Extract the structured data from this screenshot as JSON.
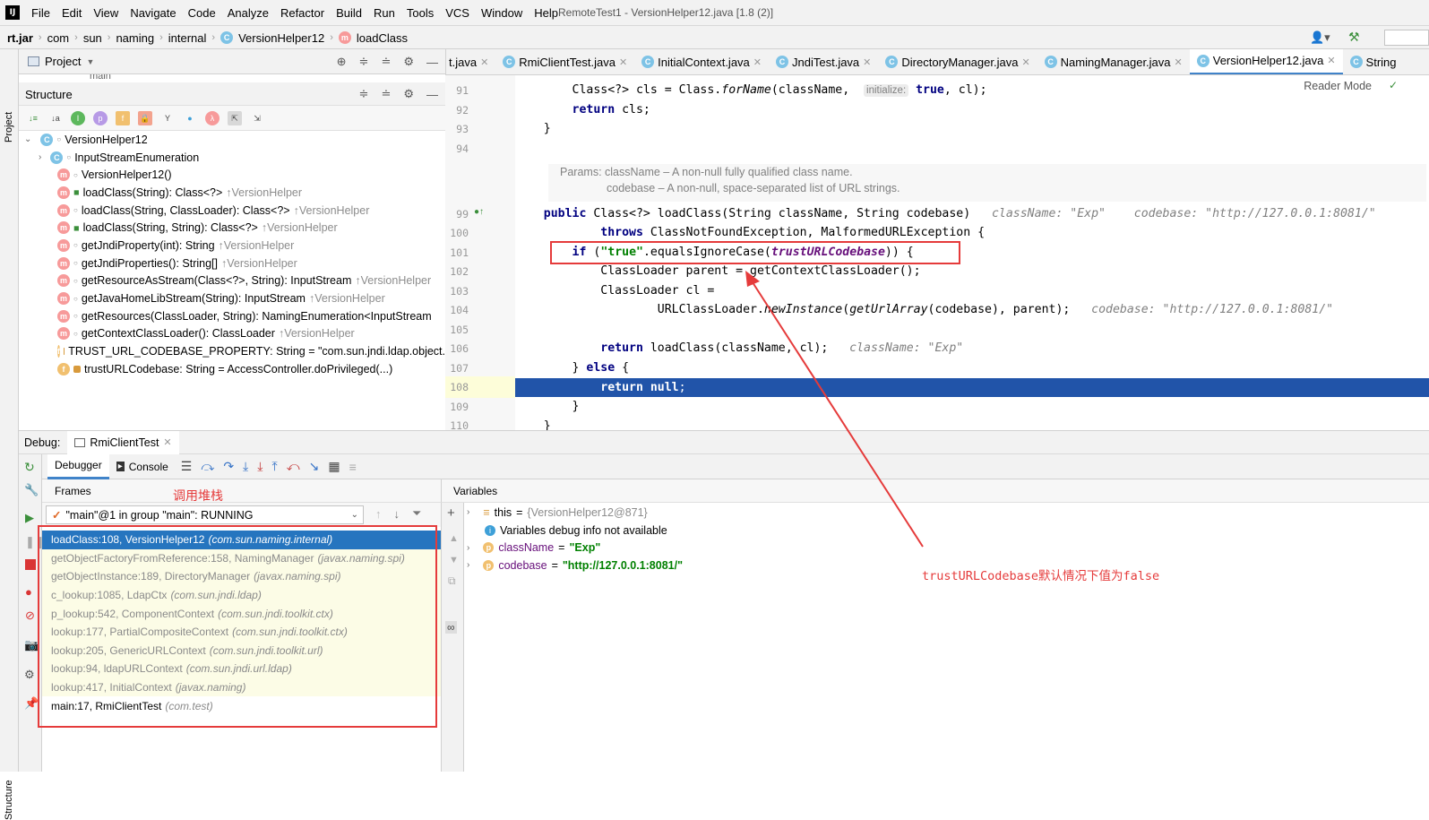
{
  "menubar": {
    "logo": "IJ",
    "items": [
      "File",
      "Edit",
      "View",
      "Navigate",
      "Code",
      "Analyze",
      "Refactor",
      "Build",
      "Run",
      "Tools",
      "VCS",
      "Window",
      "Help"
    ],
    "window_title": "RemoteTest1 - VersionHelper12.java [1.8 (2)]"
  },
  "breadcrumb": {
    "items": [
      "rt.jar",
      "com",
      "sun",
      "naming",
      "internal",
      "VersionHelper12",
      "loadClass"
    ]
  },
  "project_panel": {
    "title": "Project",
    "hidden_row": "main"
  },
  "left_strip": {
    "project": "Project",
    "structure": "Structure"
  },
  "structure": {
    "title": "Structure",
    "root": "VersionHelper12",
    "items": [
      {
        "icon": "c",
        "name": "InputStreamEnumeration",
        "type": "",
        "inherit": "",
        "expand": true
      },
      {
        "icon": "m",
        "name": "VersionHelper12()",
        "type": "",
        "inherit": ""
      },
      {
        "icon": "m",
        "name": "loadClass(String): Class<?>",
        "type": "",
        "inherit": "↑VersionHelper"
      },
      {
        "icon": "m",
        "name": "loadClass(String, ClassLoader): Class<?>",
        "type": "",
        "inherit": "↑VersionHelper"
      },
      {
        "icon": "m",
        "name": "loadClass(String, String): Class<?>",
        "type": "",
        "inherit": "↑VersionHelper"
      },
      {
        "icon": "m",
        "name": "getJndiProperty(int): String",
        "type": "",
        "inherit": "↑VersionHelper"
      },
      {
        "icon": "m",
        "name": "getJndiProperties(): String[]",
        "type": "",
        "inherit": "↑VersionHelper"
      },
      {
        "icon": "m",
        "name": "getResourceAsStream(Class<?>, String): InputStream",
        "type": "",
        "inherit": "↑VersionHelper"
      },
      {
        "icon": "m",
        "name": "getJavaHomeLibStream(String): InputStream",
        "type": "",
        "inherit": "↑VersionHelper"
      },
      {
        "icon": "m",
        "name": "getResources(ClassLoader, String): NamingEnumeration<InputStream",
        "type": "",
        "inherit": ""
      },
      {
        "icon": "m",
        "name": "getContextClassLoader(): ClassLoader",
        "type": "",
        "inherit": "↑VersionHelper"
      },
      {
        "icon": "f",
        "name": "TRUST_URL_CODEBASE_PROPERTY: String = \"com.sun.jndi.ldap.object.",
        "type": "",
        "inherit": ""
      },
      {
        "icon": "f",
        "name": "trustURLCodebase: String = AccessController.doPrivileged(...)",
        "type": "",
        "inherit": ""
      }
    ]
  },
  "editor_tabs": [
    {
      "label": "t.java",
      "active": false
    },
    {
      "label": "RmiClientTest.java",
      "active": false
    },
    {
      "label": "InitialContext.java",
      "active": false
    },
    {
      "label": "JndiTest.java",
      "active": false
    },
    {
      "label": "DirectoryManager.java",
      "active": false
    },
    {
      "label": "NamingManager.java",
      "active": false
    },
    {
      "label": "VersionHelper12.java",
      "active": true
    },
    {
      "label": "String",
      "active": false
    }
  ],
  "editor": {
    "reader_mode": "Reader Mode",
    "line_numbers": [
      "91",
      "92",
      "93",
      "94",
      "99",
      "100",
      "101",
      "102",
      "103",
      "104",
      "105",
      "106",
      "107",
      "108",
      "109",
      "110"
    ],
    "doc_line1": "Params: className – A non-null fully qualified class name.",
    "doc_line2": "codebase – A non-null, space-separated list of URL strings."
  },
  "debug": {
    "label": "Debug:",
    "session": "RmiClientTest",
    "tabs": [
      "Debugger",
      "Console"
    ],
    "frames_title": "Frames",
    "variables_title": "Variables",
    "thread": "\"main\"@1 in group \"main\": RUNNING",
    "frames": [
      {
        "method": "loadClass:108, VersionHelper12",
        "pkg": "(com.sun.naming.internal)"
      },
      {
        "method": "getObjectFactoryFromReference:158, NamingManager",
        "pkg": "(javax.naming.spi)"
      },
      {
        "method": "getObjectInstance:189, DirectoryManager",
        "pkg": "(javax.naming.spi)"
      },
      {
        "method": "c_lookup:1085, LdapCtx",
        "pkg": "(com.sun.jndi.ldap)"
      },
      {
        "method": "p_lookup:542, ComponentContext",
        "pkg": "(com.sun.jndi.toolkit.ctx)"
      },
      {
        "method": "lookup:177, PartialCompositeContext",
        "pkg": "(com.sun.jndi.toolkit.ctx)"
      },
      {
        "method": "lookup:205, GenericURLContext",
        "pkg": "(com.sun.jndi.toolkit.url)"
      },
      {
        "method": "lookup:94, ldapURLContext",
        "pkg": "(com.sun.jndi.url.ldap)"
      },
      {
        "method": "lookup:417, InitialContext",
        "pkg": "(javax.naming)"
      },
      {
        "method": "main:17, RmiClientTest",
        "pkg": "(com.test)"
      }
    ],
    "variables": {
      "this_name": "this",
      "this_value": "{VersionHelper12@871}",
      "info": "Variables debug info not available",
      "var1_name": "className",
      "var1_value": "\"Exp\"",
      "var2_name": "codebase",
      "var2_value": "\"http://127.0.0.1:8081/\""
    }
  },
  "annotations": {
    "stack_label": "调用堆栈",
    "trust_note": "trustURLCodebase默认情况下值为false"
  },
  "colors": {
    "selection": "#2675bf",
    "exec_line": "#2154a9",
    "annotation": "#e53b3b"
  }
}
